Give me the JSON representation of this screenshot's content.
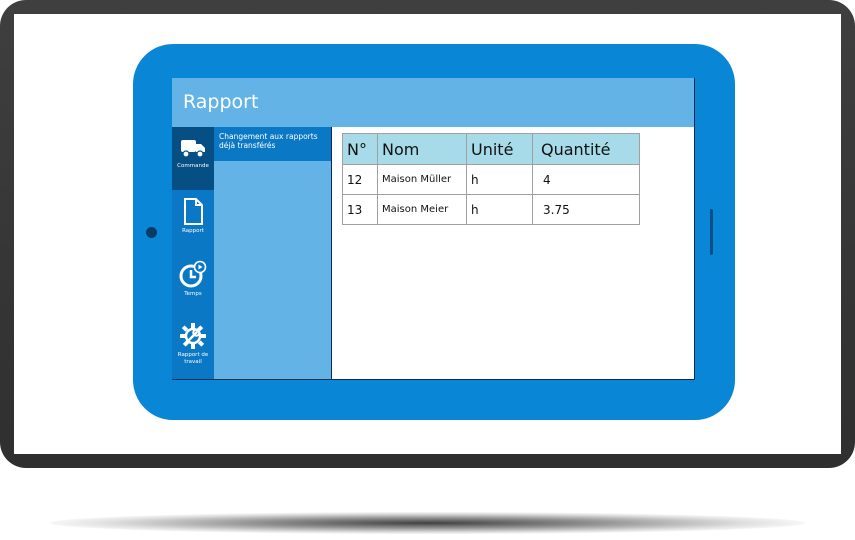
{
  "app": {
    "title": "Rapport"
  },
  "nav": {
    "items": [
      {
        "label": "Commande",
        "icon": "truck-icon",
        "active": true
      },
      {
        "label": "Rapport",
        "icon": "document-icon",
        "active": false
      },
      {
        "label": "Temps",
        "icon": "clock-icon",
        "active": false
      },
      {
        "label": "Rapport de travail",
        "icon": "gear-wrench-icon",
        "active": false
      }
    ]
  },
  "subpanel": {
    "items": [
      {
        "label": "Changement aux rapports déjà transférés",
        "selected": true
      }
    ]
  },
  "table": {
    "headers": [
      "N°",
      "Nom",
      "Unité",
      "Quantité"
    ],
    "rows": [
      {
        "no": "12",
        "nom": "Maison Müller",
        "unite": "h",
        "quantite": "4"
      },
      {
        "no": "13",
        "nom": "Maison Meier",
        "unite": "h",
        "quantite": "3.75"
      }
    ]
  },
  "colors": {
    "tablet": "#0a86d6",
    "header": "#64b3e6",
    "nav": "#0a78c4",
    "nav_active": "#064f85",
    "table_header": "#a8dbe9",
    "monitor": "#333333"
  }
}
